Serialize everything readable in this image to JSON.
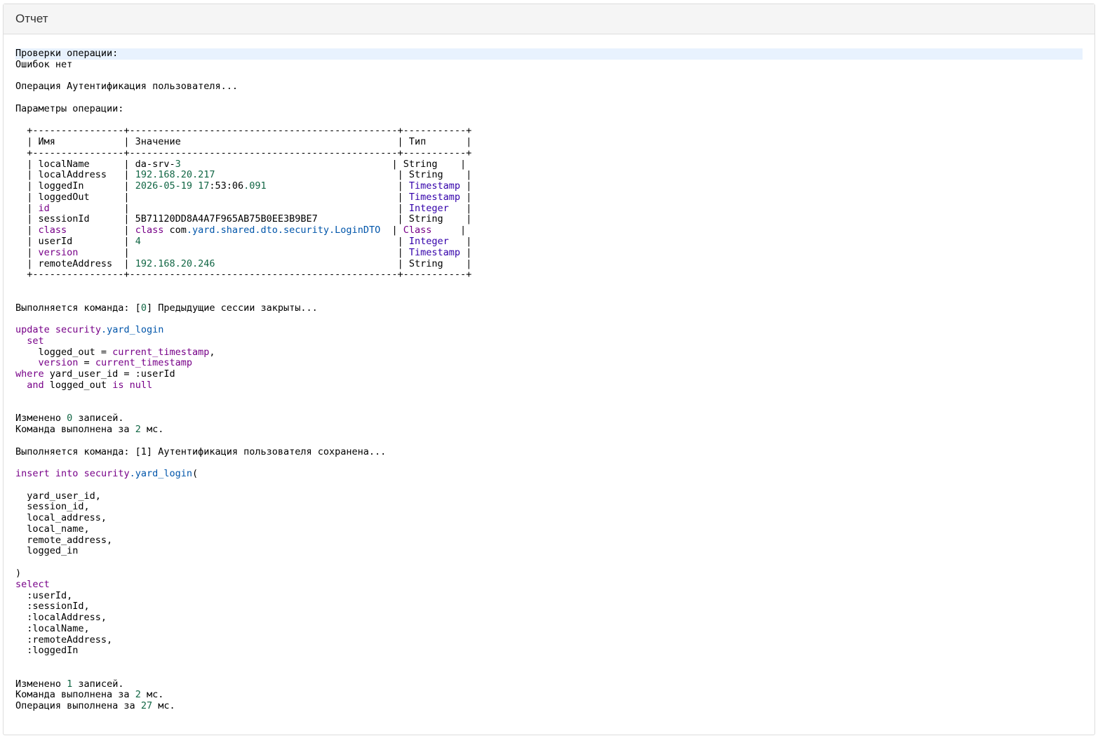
{
  "header": {
    "title": "Отчет"
  },
  "report": {
    "lines": [
      [
        {
          "t": "Проверки операции:"
        }
      ],
      [
        {
          "t": "Ошибок нет"
        }
      ],
      [],
      [
        {
          "t": "Операция Аутентификация пользователя..."
        }
      ],
      [],
      [
        {
          "t": "Параметры операции:"
        }
      ],
      [],
      [
        {
          "t": "  +----------------+-----------------------------------------------+-----------+"
        }
      ],
      [
        {
          "t": "  | Имя            | Значение                                      | Тип       |"
        }
      ],
      [
        {
          "t": "  +----------------+-----------------------------------------------+-----------+"
        }
      ],
      [
        {
          "t": "  | localName      | da-srv-"
        },
        {
          "t": "3",
          "c": "num"
        },
        {
          "t": "                                     | String    |"
        }
      ],
      [
        {
          "t": "  | localAddress   | "
        },
        {
          "t": "192.168.20.217",
          "c": "num"
        },
        {
          "t": "                                | String    |"
        }
      ],
      [
        {
          "t": "  | loggedIn       | "
        },
        {
          "t": "2026-05-19",
          "c": "num"
        },
        {
          "t": " "
        },
        {
          "t": "17",
          "c": "num"
        },
        {
          "t": ":53:06"
        },
        {
          "t": ".091",
          "c": "num"
        },
        {
          "t": "                       | "
        },
        {
          "t": "Timestamp",
          "c": "typ"
        },
        {
          "t": " |"
        }
      ],
      [
        {
          "t": "  | loggedOut      |                                               | "
        },
        {
          "t": "Timestamp",
          "c": "typ"
        },
        {
          "t": " |"
        }
      ],
      [
        {
          "t": "  | "
        },
        {
          "t": "id",
          "c": "kw"
        },
        {
          "t": "             |                                               | "
        },
        {
          "t": "Integer",
          "c": "typ"
        },
        {
          "t": "   |"
        }
      ],
      [
        {
          "t": "  | sessionId      | 5B71120DD8A4A7F965AB75B0EE3B9BE7              | String    |"
        }
      ],
      [
        {
          "t": "  | "
        },
        {
          "t": "class",
          "c": "kw"
        },
        {
          "t": "          | "
        },
        {
          "t": "class",
          "c": "kw"
        },
        {
          "t": " com"
        },
        {
          "t": ".yard.shared.dto.security.LoginDTO",
          "c": "var"
        },
        {
          "t": "  | "
        },
        {
          "t": "Class",
          "c": "kw"
        },
        {
          "t": "     |"
        }
      ],
      [
        {
          "t": "  | userId         | "
        },
        {
          "t": "4",
          "c": "num"
        },
        {
          "t": "                                             | "
        },
        {
          "t": "Integer",
          "c": "typ"
        },
        {
          "t": "   |"
        }
      ],
      [
        {
          "t": "  | "
        },
        {
          "t": "version",
          "c": "kw"
        },
        {
          "t": "        |                                               | "
        },
        {
          "t": "Timestamp",
          "c": "typ"
        },
        {
          "t": " |"
        }
      ],
      [
        {
          "t": "  | remoteAddress  | "
        },
        {
          "t": "192.168.20.246",
          "c": "num"
        },
        {
          "t": "                                | String    |"
        }
      ],
      [
        {
          "t": "  +----------------+-----------------------------------------------+-----------+"
        }
      ],
      [],
      [],
      [
        {
          "t": "Выполняется команда: ["
        },
        {
          "t": "0",
          "c": "num"
        },
        {
          "t": "] Предыдущие сессии закрыты..."
        }
      ],
      [],
      [
        {
          "t": "update",
          "c": "kw"
        },
        {
          "t": " "
        },
        {
          "t": "security",
          "c": "kw"
        },
        {
          "t": ".yard_login",
          "c": "var"
        }
      ],
      [
        {
          "t": "  "
        },
        {
          "t": "set",
          "c": "kw"
        }
      ],
      [
        {
          "t": "    logged_out = "
        },
        {
          "t": "current_timestamp",
          "c": "kw"
        },
        {
          "t": ","
        }
      ],
      [
        {
          "t": "    "
        },
        {
          "t": "version",
          "c": "kw"
        },
        {
          "t": " = "
        },
        {
          "t": "current_timestamp",
          "c": "kw"
        }
      ],
      [
        {
          "t": "where",
          "c": "kw"
        },
        {
          "t": " yard_user_id = :userId"
        }
      ],
      [
        {
          "t": "  "
        },
        {
          "t": "and",
          "c": "kw"
        },
        {
          "t": " logged_out "
        },
        {
          "t": "is",
          "c": "kw"
        },
        {
          "t": " "
        },
        {
          "t": "null",
          "c": "kw"
        }
      ],
      [],
      [],
      [
        {
          "t": "Изменено "
        },
        {
          "t": "0",
          "c": "num"
        },
        {
          "t": " записей."
        }
      ],
      [
        {
          "t": "Команда выполнена за "
        },
        {
          "t": "2",
          "c": "num"
        },
        {
          "t": " мс."
        }
      ],
      [],
      [
        {
          "t": "Выполняется команда: [1] Аутентификация пользователя сохранена..."
        }
      ],
      [],
      [
        {
          "t": "insert",
          "c": "kw"
        },
        {
          "t": " "
        },
        {
          "t": "into",
          "c": "kw"
        },
        {
          "t": " "
        },
        {
          "t": "security",
          "c": "kw"
        },
        {
          "t": ".yard_login",
          "c": "var"
        },
        {
          "t": "("
        }
      ],
      [],
      [
        {
          "t": "  yard_user_id,"
        }
      ],
      [
        {
          "t": "  session_id,"
        }
      ],
      [
        {
          "t": "  local_address,"
        }
      ],
      [
        {
          "t": "  local_name,"
        }
      ],
      [
        {
          "t": "  remote_address,"
        }
      ],
      [
        {
          "t": "  logged_in"
        }
      ],
      [],
      [
        {
          "t": ")"
        }
      ],
      [
        {
          "t": "select",
          "c": "kw"
        }
      ],
      [
        {
          "t": "  :userId,"
        }
      ],
      [
        {
          "t": "  :sessionId,"
        }
      ],
      [
        {
          "t": "  :localAddress,"
        }
      ],
      [
        {
          "t": "  :localName,"
        }
      ],
      [
        {
          "t": "  :remoteAddress,"
        }
      ],
      [
        {
          "t": "  :loggedIn"
        }
      ],
      [],
      [],
      [
        {
          "t": "Изменено "
        },
        {
          "t": "1",
          "c": "num"
        },
        {
          "t": " записей."
        }
      ],
      [
        {
          "t": "Команда выполнена за "
        },
        {
          "t": "2",
          "c": "num"
        },
        {
          "t": " мс."
        }
      ],
      [
        {
          "t": "Операция выполнена за "
        },
        {
          "t": "27",
          "c": "num"
        },
        {
          "t": " мс."
        }
      ]
    ],
    "highlight_line": 0
  },
  "colors": {
    "keyword": "#770088",
    "number": "#116644",
    "type": "#3300aa",
    "variable": "#0055aa",
    "highlight": "#e8f2fe"
  }
}
